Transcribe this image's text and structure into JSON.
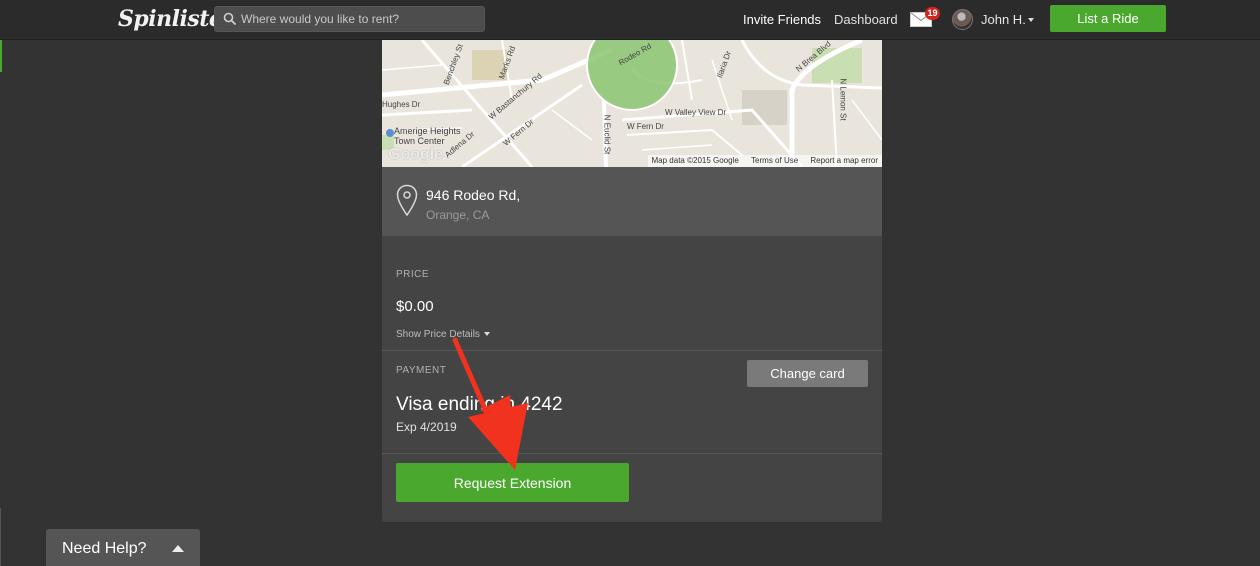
{
  "header": {
    "logo": "Spinlister",
    "search_placeholder": "Where would you like to rent?",
    "invite_friends": "Invite Friends",
    "dashboard": "Dashboard",
    "mail_count": "19",
    "user_name": "John H.",
    "list_button": "List a Ride"
  },
  "map": {
    "labels": [
      "Rodeo Rd",
      "Hughes Dr",
      "W Bastanchury Rd",
      "Amerige Heights",
      "Town Center",
      "W Fern Dr",
      "N Euclid St",
      "W Valley View Dr",
      "W Fern Dr",
      "N Brea Blvd",
      "N Lemon St",
      "Adlena Dr",
      "Benchley St",
      "Ilaria Dr",
      "Marks Rd"
    ],
    "google": "Google",
    "map_data": "Map data ©2015 Google",
    "terms": "Terms of Use",
    "report": "Report a map error"
  },
  "address": {
    "line1": "946 Rodeo Rd,",
    "line2": "Orange, CA"
  },
  "price": {
    "label": "PRICE",
    "value": "$0.00",
    "details_link": "Show Price Details"
  },
  "payment": {
    "label": "PAYMENT",
    "change_button": "Change card",
    "card_name": "Visa ending in 4242",
    "expiry": "Exp 4/2019"
  },
  "request_button": "Request Extension",
  "help": {
    "label": "Need Help?"
  },
  "colors": {
    "accent_green": "#4ba82e",
    "badge_red": "#d0261f",
    "arrow_red": "#f0321e"
  }
}
